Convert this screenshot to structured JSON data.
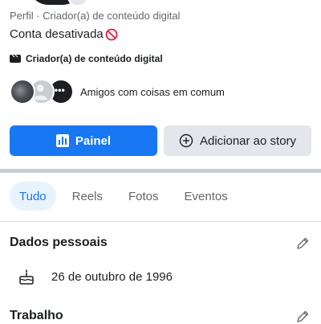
{
  "profile": {
    "meta_line": "Perfil · Criador(a) de conteúdo digital",
    "status_text": "Conta desativada",
    "category_label": "Criador(a) de conteúdo digital",
    "mutual_friends_label": "Amigos com coisas em comum"
  },
  "actions": {
    "dashboard_label": "Painel",
    "add_story_label": "Adicionar ao story"
  },
  "tabs": [
    {
      "label": "Tudo",
      "active": true
    },
    {
      "label": "Reels",
      "active": false
    },
    {
      "label": "Fotos",
      "active": false
    },
    {
      "label": "Eventos",
      "active": false
    }
  ],
  "sections": {
    "personal": {
      "title": "Dados pessoais",
      "birthday": "26 de outubro de 1996"
    },
    "work": {
      "title": "Trabalho"
    }
  },
  "colors": {
    "accent": "#1877f2",
    "accent_tint": "#e7f3ff",
    "secondary_button": "#e4e6eb",
    "ban_red": "#e41e3f"
  },
  "icons": {
    "status": "prohibited-icon",
    "category": "video-camera-icon",
    "dashboard": "bar-chart-icon",
    "add_story": "plus-circle-icon",
    "edit": "pencil-icon",
    "birthday": "cake-icon",
    "friend_more": "more-dots-icon"
  }
}
